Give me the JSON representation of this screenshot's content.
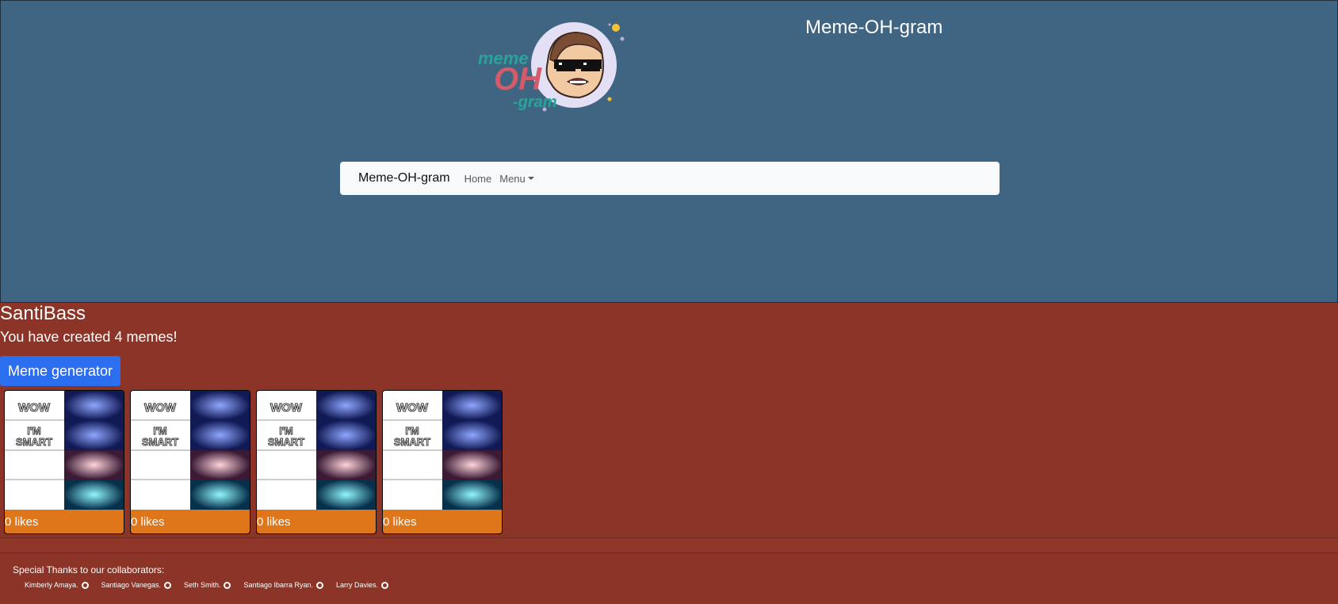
{
  "header": {
    "title": "Meme-OH-gram",
    "logo_text": [
      "meme",
      "OH",
      "-gram"
    ]
  },
  "navbar": {
    "brand": "Meme-OH-gram",
    "home": "Home",
    "menu": "Menu"
  },
  "profile": {
    "username": "SantiBass",
    "meme_count_text": "You have created 4 memes!",
    "generator_button": "Meme generator"
  },
  "memes": [
    {
      "top_text": "WOW",
      "bottom_text": "I'M SMART",
      "likes": "0 likes"
    },
    {
      "top_text": "WOW",
      "bottom_text": "I'M SMART",
      "likes": "0 likes"
    },
    {
      "top_text": "WOW",
      "bottom_text": "I'M SMART",
      "likes": "0 likes"
    },
    {
      "top_text": "WOW",
      "bottom_text": "I'M SMART",
      "likes": "0 likes"
    }
  ],
  "footer": {
    "thanks": "Special Thanks to our collaborators:",
    "collaborators": [
      "Kimberly Amaya.",
      "Santiago Vanegas.",
      "Seth Smith.",
      "Santiago Ibarra Ryan.",
      "Larry Davies."
    ]
  },
  "icons": {
    "collaborator": "github-icon",
    "menu": "caret-down-icon"
  },
  "colors": {
    "header_bg": "#406582",
    "page_bg": "#8b3427",
    "button": "#2c6ef0",
    "card_footer": "#e0761a",
    "navbar_bg": "#f8f9fa"
  }
}
